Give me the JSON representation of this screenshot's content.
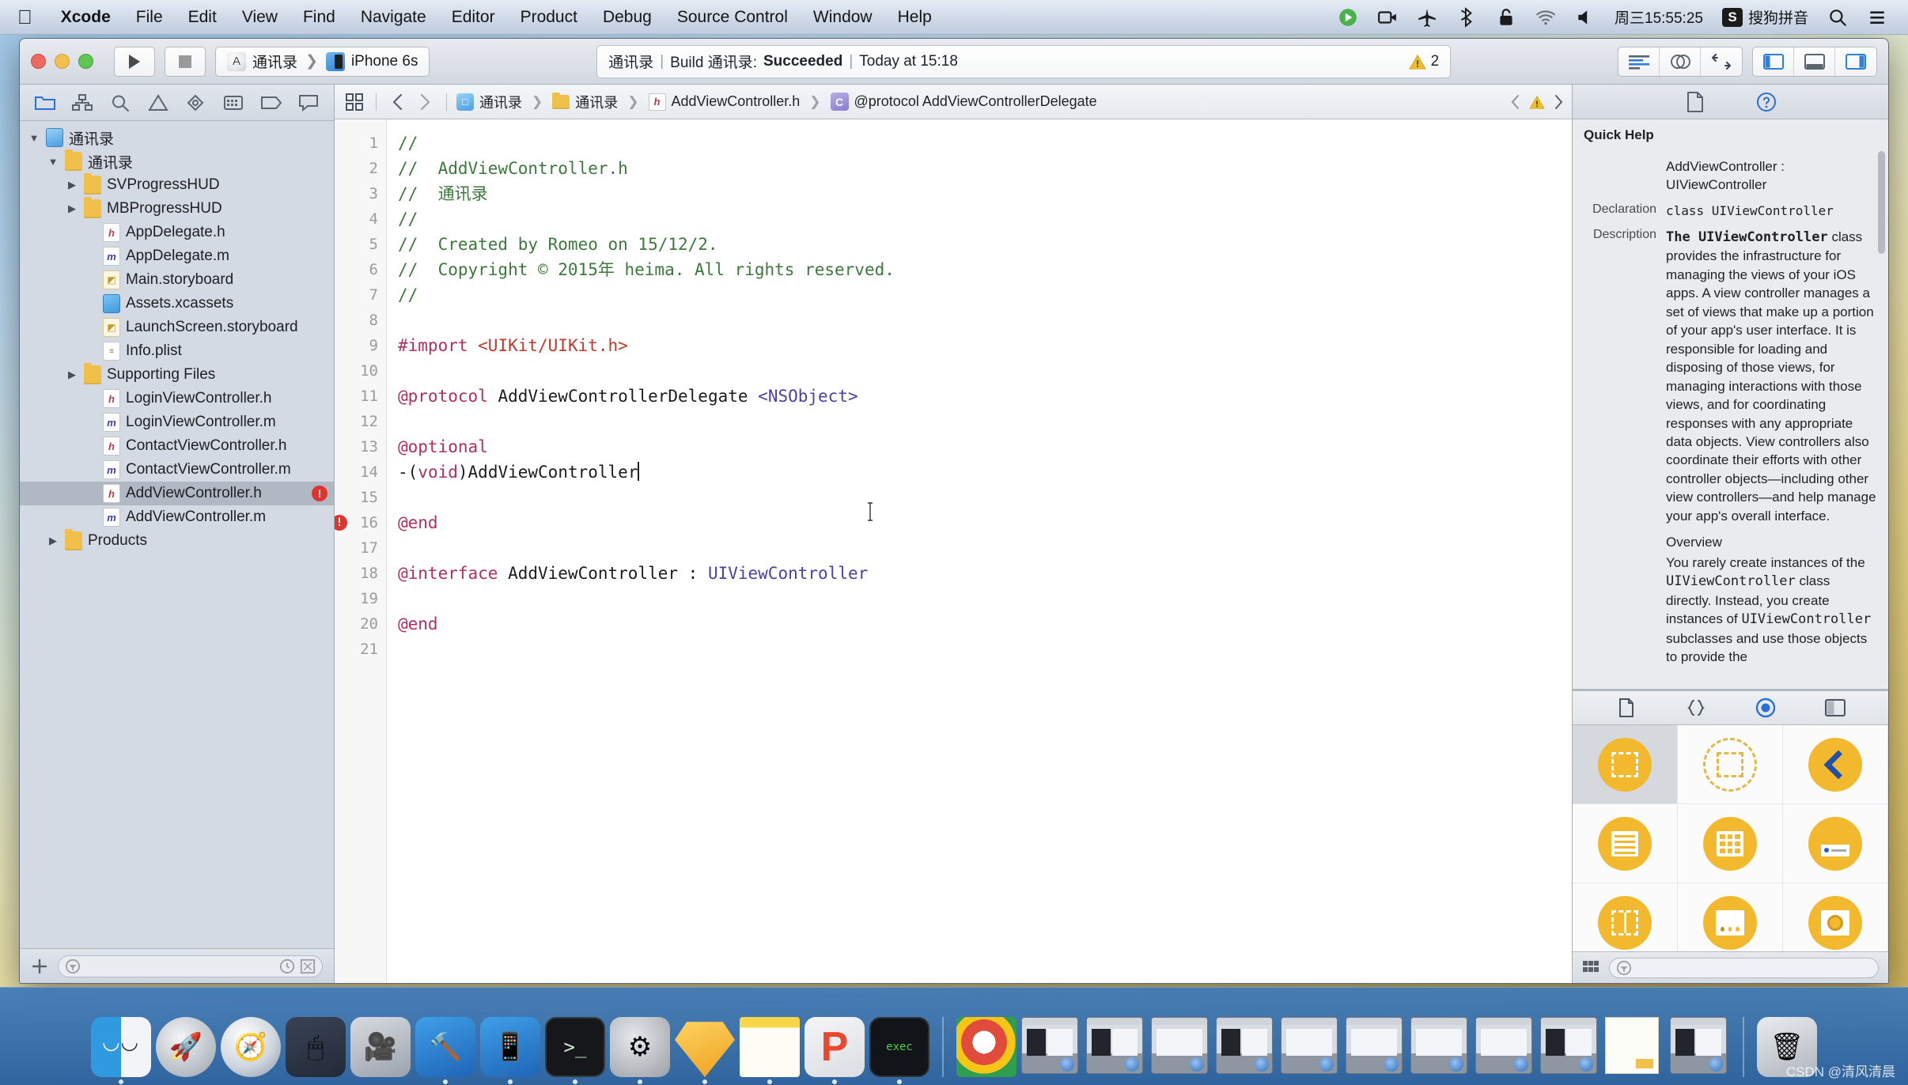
{
  "menubar": {
    "apple_icon": "apple-logo-icon",
    "items": [
      {
        "label": "Xcode",
        "bold": true
      },
      {
        "label": "File",
        "bold": false
      },
      {
        "label": "Edit",
        "bold": false
      },
      {
        "label": "View",
        "bold": false
      },
      {
        "label": "Find",
        "bold": false
      },
      {
        "label": "Navigate",
        "bold": false
      },
      {
        "label": "Editor",
        "bold": false
      },
      {
        "label": "Product",
        "bold": false
      },
      {
        "label": "Debug",
        "bold": false
      },
      {
        "label": "Source Control",
        "bold": false
      },
      {
        "label": "Window",
        "bold": false
      },
      {
        "label": "Help",
        "bold": false
      }
    ],
    "status_icons": [
      "record-green-icon",
      "screen-record-icon",
      "airplane-icon",
      "bluetooth-icon",
      "lock-icon",
      "wifi-icon",
      "volume-icon"
    ],
    "clock": "周三15:55:25",
    "input_method_badge": "S",
    "input_method": "搜狗拼音",
    "search_icon": "spotlight-search-icon",
    "notification_icon": "notification-center-icon"
  },
  "toolbar": {
    "run_icon": "run-play-icon",
    "stop_icon": "stop-square-icon",
    "scheme_project": "通讯录",
    "scheme_separator": "❯",
    "scheme_destination": "iPhone 6s",
    "status": {
      "project": "通讯录",
      "divider": "|",
      "build_prefix": "Build 通讯录:",
      "build_result": "Succeeded",
      "time": "Today at 15:18",
      "warning_count": "2"
    },
    "editor_buttons": [
      "standard-editor-icon",
      "assistant-editor-icon",
      "version-editor-icon"
    ],
    "view_buttons": [
      "toggle-navigator-icon",
      "toggle-debug-area-icon",
      "toggle-utilities-icon"
    ]
  },
  "navigator": {
    "tabs": [
      "project-navigator-icon",
      "symbol-navigator-icon",
      "find-navigator-icon",
      "issue-navigator-icon",
      "test-navigator-icon",
      "debug-navigator-icon",
      "breakpoint-navigator-icon",
      "report-navigator-icon"
    ],
    "tree": [
      {
        "label": "通讯录",
        "icon": "proj",
        "indent": 0,
        "arrow": "down",
        "selected": false,
        "error": false
      },
      {
        "label": "通讯录",
        "icon": "folder",
        "indent": 1,
        "arrow": "down",
        "selected": false,
        "error": false
      },
      {
        "label": "SVProgressHUD",
        "icon": "folder",
        "indent": 2,
        "arrow": "right",
        "selected": false,
        "error": false
      },
      {
        "label": "MBProgressHUD",
        "icon": "folder",
        "indent": 2,
        "arrow": "right",
        "selected": false,
        "error": false
      },
      {
        "label": "AppDelegate.h",
        "icon": "h",
        "indent": 3,
        "arrow": "none",
        "selected": false,
        "error": false
      },
      {
        "label": "AppDelegate.m",
        "icon": "m",
        "indent": 3,
        "arrow": "none",
        "selected": false,
        "error": false
      },
      {
        "label": "Main.storyboard",
        "icon": "sb",
        "indent": 3,
        "arrow": "none",
        "selected": false,
        "error": false
      },
      {
        "label": "Assets.xcassets",
        "icon": "asset",
        "indent": 3,
        "arrow": "none",
        "selected": false,
        "error": false
      },
      {
        "label": "LaunchScreen.storyboard",
        "icon": "sb",
        "indent": 3,
        "arrow": "none",
        "selected": false,
        "error": false
      },
      {
        "label": "Info.plist",
        "icon": "plist",
        "indent": 3,
        "arrow": "none",
        "selected": false,
        "error": false
      },
      {
        "label": "Supporting Files",
        "icon": "folder",
        "indent": 2,
        "arrow": "right",
        "selected": false,
        "error": false
      },
      {
        "label": "LoginViewController.h",
        "icon": "h",
        "indent": 3,
        "arrow": "none",
        "selected": false,
        "error": false
      },
      {
        "label": "LoginViewController.m",
        "icon": "m",
        "indent": 3,
        "arrow": "none",
        "selected": false,
        "error": false
      },
      {
        "label": "ContactViewController.h",
        "icon": "h",
        "indent": 3,
        "arrow": "none",
        "selected": false,
        "error": false
      },
      {
        "label": "ContactViewController.m",
        "icon": "m",
        "indent": 3,
        "arrow": "none",
        "selected": false,
        "error": false
      },
      {
        "label": "AddViewController.h",
        "icon": "h",
        "indent": 3,
        "arrow": "none",
        "selected": true,
        "error": true
      },
      {
        "label": "AddViewController.m",
        "icon": "m",
        "indent": 3,
        "arrow": "none",
        "selected": false,
        "error": false
      },
      {
        "label": "Products",
        "icon": "folder",
        "indent": 1,
        "arrow": "right",
        "selected": false,
        "error": false
      }
    ],
    "footer": {
      "add_icon": "add-plus-icon",
      "filter_icon": "filter-circle-icon",
      "filter_placeholder": "",
      "recent_icon": "recent-clock-icon",
      "source-control_icon": "source-control-filter-icon"
    }
  },
  "jumpbar": {
    "related_icon": "related-items-icon",
    "back_icon": "chevron-left-icon",
    "forward_icon": "chevron-right-icon",
    "crumbs": [
      {
        "label": "通讯录",
        "icon": "proj"
      },
      {
        "label": "通讯录",
        "icon": "folder"
      },
      {
        "label": "AddViewController.h",
        "icon": "h"
      },
      {
        "label": "@protocol AddViewControllerDelegate",
        "icon": "c"
      }
    ],
    "right_icons": [
      "chevron-left-icon",
      "warning-triangle-icon",
      "chevron-right-icon"
    ]
  },
  "editor": {
    "lines": [
      {
        "n": "1",
        "error": false,
        "tokens": [
          {
            "t": "//",
            "c": "c-cm"
          }
        ]
      },
      {
        "n": "2",
        "error": false,
        "tokens": [
          {
            "t": "//  AddViewController.h",
            "c": "c-cm"
          }
        ]
      },
      {
        "n": "3",
        "error": false,
        "tokens": [
          {
            "t": "//  通讯录",
            "c": "c-cm"
          }
        ]
      },
      {
        "n": "4",
        "error": false,
        "tokens": [
          {
            "t": "//",
            "c": "c-cm"
          }
        ]
      },
      {
        "n": "5",
        "error": false,
        "tokens": [
          {
            "t": "//  Created by Romeo on 15/12/2.",
            "c": "c-cm"
          }
        ]
      },
      {
        "n": "6",
        "error": false,
        "tokens": [
          {
            "t": "//  Copyright © 2015年 heima. All rights reserved.",
            "c": "c-cm"
          }
        ]
      },
      {
        "n": "7",
        "error": false,
        "tokens": [
          {
            "t": "//",
            "c": "c-cm"
          }
        ]
      },
      {
        "n": "8",
        "error": false,
        "tokens": []
      },
      {
        "n": "9",
        "error": false,
        "tokens": [
          {
            "t": "#import ",
            "c": "c-pre"
          },
          {
            "t": "<UIKit/UIKit.h>",
            "c": "c-str"
          }
        ]
      },
      {
        "n": "10",
        "error": false,
        "tokens": []
      },
      {
        "n": "11",
        "error": false,
        "tokens": [
          {
            "t": "@protocol ",
            "c": "c-kw"
          },
          {
            "t": "AddViewControllerDelegate ",
            "c": "c-plain"
          },
          {
            "t": "<NSObject>",
            "c": "c-type"
          }
        ]
      },
      {
        "n": "12",
        "error": false,
        "tokens": []
      },
      {
        "n": "13",
        "error": false,
        "tokens": [
          {
            "t": "@optional",
            "c": "c-kw"
          }
        ]
      },
      {
        "n": "14",
        "error": false,
        "caret": true,
        "tokens": [
          {
            "t": "-(",
            "c": "c-plain"
          },
          {
            "t": "void",
            "c": "c-kw"
          },
          {
            "t": ")",
            "c": "c-plain"
          },
          {
            "t": "AddViewController",
            "c": "c-plain"
          }
        ]
      },
      {
        "n": "15",
        "error": false,
        "tokens": []
      },
      {
        "n": "16",
        "error": true,
        "tokens": [
          {
            "t": "@end",
            "c": "c-kw"
          }
        ]
      },
      {
        "n": "17",
        "error": false,
        "tokens": []
      },
      {
        "n": "18",
        "error": false,
        "tokens": [
          {
            "t": "@interface ",
            "c": "c-kw"
          },
          {
            "t": "AddViewController ",
            "c": "c-plain"
          },
          {
            "t": ": ",
            "c": "c-plain"
          },
          {
            "t": "UIViewController",
            "c": "c-type"
          }
        ]
      },
      {
        "n": "19",
        "error": false,
        "tokens": []
      },
      {
        "n": "20",
        "error": false,
        "tokens": [
          {
            "t": "@end",
            "c": "c-kw"
          }
        ]
      },
      {
        "n": "21",
        "error": false,
        "tokens": []
      }
    ]
  },
  "utilities": {
    "tabs": [
      "file-inspector-icon",
      "quick-help-inspector-icon"
    ],
    "quick_help": {
      "title": "Quick Help",
      "symbol_line1": "AddViewController :",
      "symbol_line2": "UIViewController",
      "declaration_label": "Declaration",
      "declaration_value": "class UIViewController",
      "description_label": "Description",
      "description_lead": "The UIViewController",
      "description_body": "class provides the infrastructure for managing the views of your iOS apps. A view controller manages a set of views that make up a portion of your app's user interface. It is responsible for loading and disposing of those views, for managing interactions with those views, and for coordinating responses with any appropriate data objects. View controllers also coordinate their efforts with other controller objects—including other view controllers—and help manage your app's overall interface.",
      "overview_heading": "Overview",
      "overview_part1": "You rarely create instances of the ",
      "overview_mono1": "UIViewController",
      "overview_part2": " class directly. Instead, you create instances of ",
      "overview_mono2": "UIViewController",
      "overview_part3": " subclasses and use those objects to provide the"
    },
    "library_tabs": [
      "file-template-library-icon",
      "code-snippet-library-icon",
      "object-library-icon",
      "media-library-icon"
    ],
    "library_items": [
      {
        "name": "view-object",
        "selected": true
      },
      {
        "name": "view-controller-object",
        "selected": false
      },
      {
        "name": "navigation-controller-object",
        "selected": false
      },
      {
        "name": "table-view-object",
        "selected": false
      },
      {
        "name": "collection-view-object",
        "selected": false
      },
      {
        "name": "table-view-cell-object",
        "selected": false
      },
      {
        "name": "split-view-controller-object",
        "selected": false
      },
      {
        "name": "page-view-controller-object",
        "selected": false
      },
      {
        "name": "image-view-object",
        "selected": false
      }
    ],
    "library_footer": {
      "grid_icon": "grid-view-icon",
      "filter_icon": "filter-circle-icon",
      "filter_placeholder": ""
    }
  },
  "dock": {
    "items": [
      {
        "name": "finder",
        "class": "g-finder",
        "running": true
      },
      {
        "name": "launchpad",
        "class": "g-launch",
        "running": false
      },
      {
        "name": "safari",
        "class": "g-safari",
        "running": false
      },
      {
        "name": "mouse-app",
        "class": "g-mouse",
        "running": false
      },
      {
        "name": "imovie",
        "class": "g-imovie",
        "running": false
      },
      {
        "name": "xcode",
        "class": "g-xcode",
        "running": true
      },
      {
        "name": "xcode-simulator",
        "class": "g-xcode2",
        "running": true
      },
      {
        "name": "terminal",
        "class": "g-term",
        "running": true
      },
      {
        "name": "system-preferences",
        "class": "g-sys",
        "running": true
      },
      {
        "name": "sketch",
        "class": "g-sketch",
        "running": true
      },
      {
        "name": "notes",
        "class": "g-notes",
        "running": true
      },
      {
        "name": "p-app",
        "class": "g-p",
        "running": true
      },
      {
        "name": "dark-terminal",
        "class": "g-dark",
        "running": true
      }
    ],
    "minimized_count": 11,
    "trash_name": "trash"
  },
  "watermark": "CSDN @清风清晨"
}
